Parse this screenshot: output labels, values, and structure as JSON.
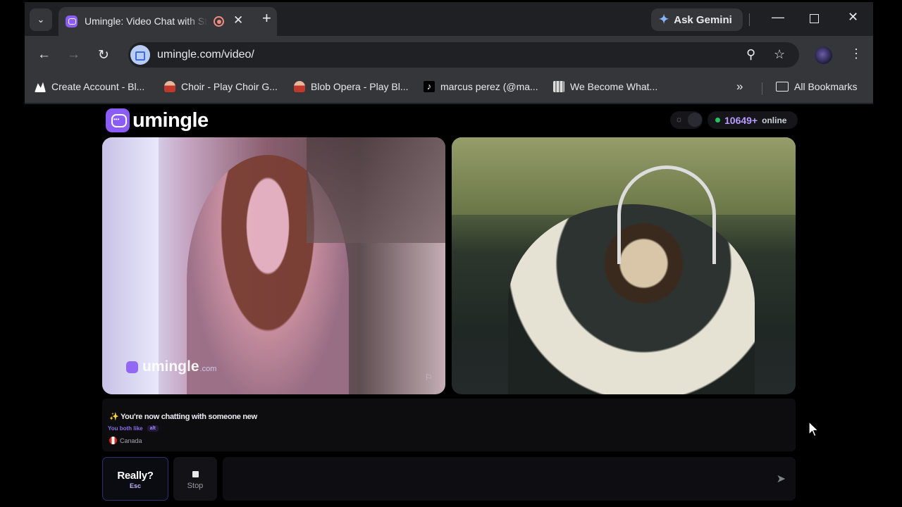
{
  "browser": {
    "tab": {
      "title": "Umingle: Video Chat with Strangers"
    },
    "ask_gemini": "Ask Gemini",
    "url": "umingle.com/video/",
    "bookmarks": [
      {
        "label": "Create Account - Bl...",
        "icon": "blooket-icon"
      },
      {
        "label": "Choir - Play Choir G...",
        "icon": "choir-icon"
      },
      {
        "label": "Blob Opera - Play Bl...",
        "icon": "blob-opera-icon"
      },
      {
        "label": "marcus perez (@ma...",
        "icon": "tiktok-icon"
      },
      {
        "label": "We Become What...",
        "icon": "game-icon"
      }
    ],
    "all_bookmarks": "All Bookmarks"
  },
  "page": {
    "logo_text": "umingle",
    "online_count": "10649+",
    "online_label": "online",
    "watermark_text": "umingle",
    "watermark_suffix": ".com",
    "chat": {
      "status": "✨ You're now chatting with someone new",
      "likes_label": "You both like",
      "likes_chip": "alt",
      "country": "Canada"
    },
    "buttons": {
      "really_label": "Really?",
      "really_shortcut": "Esc",
      "stop_label": "Stop"
    }
  }
}
